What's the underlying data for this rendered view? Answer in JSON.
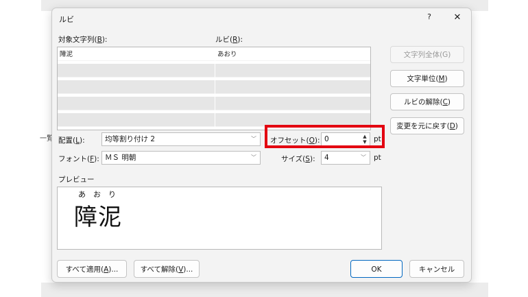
{
  "background": {
    "left_text": "一覧"
  },
  "dialog": {
    "title": "ルビ",
    "help_label": "?",
    "close_label": "✕"
  },
  "base_text": {
    "label": "対象文字列(",
    "key": "B",
    "suffix": "):"
  },
  "ruby_text": {
    "label": "ルビ(",
    "key": "R",
    "suffix": "):"
  },
  "rows": [
    {
      "base": "障泥",
      "ruby": "あおり"
    },
    {
      "base": "",
      "ruby": ""
    },
    {
      "base": "",
      "ruby": ""
    },
    {
      "base": "",
      "ruby": ""
    },
    {
      "base": "",
      "ruby": ""
    }
  ],
  "side_buttons": {
    "whole_string": "文字列全体(G)",
    "per_char_prefix": "文字単位(",
    "per_char_key": "M",
    "per_char_suffix": ")",
    "remove_prefix": "ルビの解除(",
    "remove_key": "C",
    "remove_suffix": ")",
    "reset_prefix": "変更を元に戻す(",
    "reset_key": "D",
    "reset_suffix": ")"
  },
  "alignment": {
    "label_prefix": "配置(",
    "label_key": "L",
    "label_suffix": "):",
    "value": "均等割り付け 2"
  },
  "offset": {
    "label_prefix": "オフセット(",
    "label_key": "O",
    "label_suffix": "):",
    "value": "0",
    "unit": "pt"
  },
  "font": {
    "label_prefix": "フォント(",
    "label_key": "F",
    "label_suffix": "):",
    "value": "ＭＳ 明朝"
  },
  "size": {
    "label_prefix": "サイズ(",
    "label_key": "S",
    "label_suffix": "):",
    "value": "4",
    "unit": "pt"
  },
  "preview": {
    "label": "プレビュー",
    "base": "障泥",
    "ruby_chars": [
      "あ",
      "お",
      "り"
    ]
  },
  "footer": {
    "apply_all_prefix": "すべて適用(",
    "apply_all_key": "A",
    "apply_all_suffix": ")...",
    "remove_all_prefix": "すべて解除(",
    "remove_all_key": "V",
    "remove_all_suffix": ")...",
    "ok": "OK",
    "cancel": "キャンセル"
  },
  "colors": {
    "highlight": "#e30010",
    "ok_border": "#0067c0"
  }
}
